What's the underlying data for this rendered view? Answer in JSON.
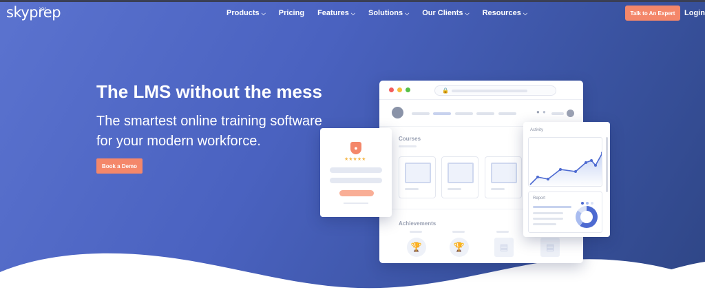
{
  "brand": {
    "logo_text": "skyprep"
  },
  "nav": {
    "items": [
      {
        "label": "Products",
        "has_dropdown": true
      },
      {
        "label": "Pricing",
        "has_dropdown": false
      },
      {
        "label": "Features",
        "has_dropdown": true
      },
      {
        "label": "Solutions",
        "has_dropdown": true
      },
      {
        "label": "Our Clients",
        "has_dropdown": true
      },
      {
        "label": "Resources",
        "has_dropdown": true
      }
    ],
    "chevron": "⌵",
    "cta_label": "Talk to An Expert",
    "login_label": "Login"
  },
  "hero": {
    "title": "The LMS without the mess",
    "subtitle": "The smartest online training software for your modern workforce.",
    "button_label": "Book a Demo"
  },
  "mockup": {
    "courses_label": "Courses",
    "achievements_label": "Achievements",
    "activity_label": "Activity",
    "report_label": "Report",
    "rating_stars": "★★★★★"
  },
  "colors": {
    "accent": "#f4876a",
    "hero_bg_start": "#5b73cf",
    "hero_bg_end": "#2f4686",
    "chart_line": "#4d6ad1"
  },
  "icons": {
    "lock": "lock-icon",
    "bell": "bell-icon",
    "trophy": "trophy-icon",
    "certificate": "certificate-icon"
  }
}
